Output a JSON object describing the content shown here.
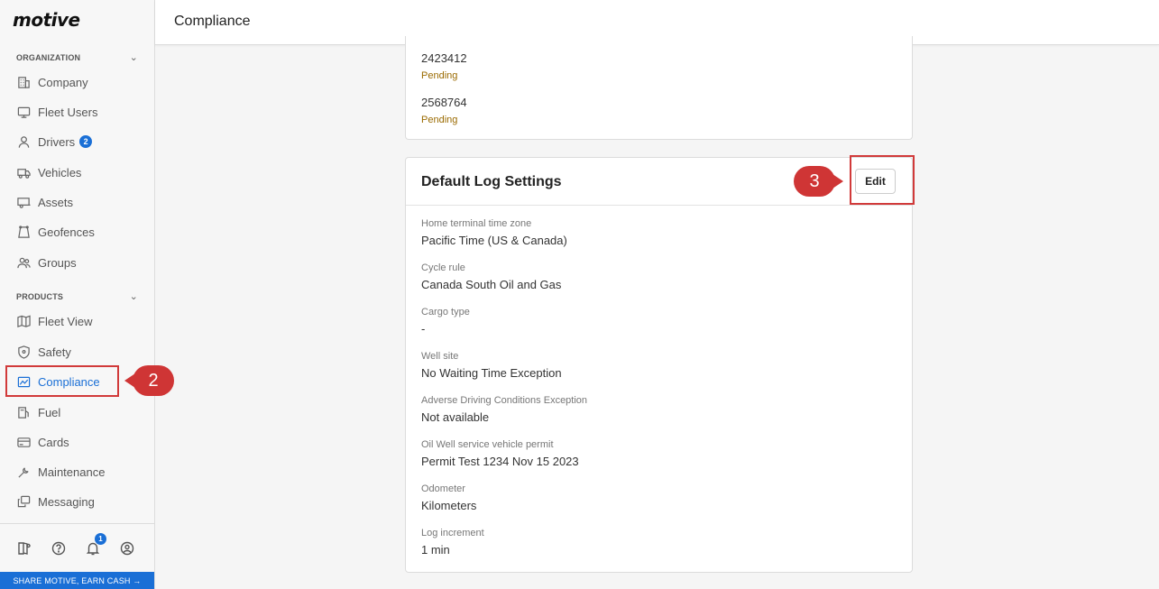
{
  "app": {
    "logo": "motive",
    "page_title": "Compliance"
  },
  "sidebar": {
    "organization_label": "ORGANIZATION",
    "products_label": "PRODUCTS",
    "org_items": [
      {
        "label": "Company",
        "icon": "building-icon"
      },
      {
        "label": "Fleet Users",
        "icon": "monitor-icon"
      },
      {
        "label": "Drivers",
        "icon": "person-icon",
        "badge": "2"
      },
      {
        "label": "Vehicles",
        "icon": "truck-icon"
      },
      {
        "label": "Assets",
        "icon": "trailer-icon"
      },
      {
        "label": "Geofences",
        "icon": "geofence-icon"
      },
      {
        "label": "Groups",
        "icon": "group-icon"
      }
    ],
    "product_items": [
      {
        "label": "Fleet View",
        "icon": "map-icon"
      },
      {
        "label": "Safety",
        "icon": "shield-icon"
      },
      {
        "label": "Compliance",
        "icon": "compliance-icon",
        "active": true
      },
      {
        "label": "Fuel",
        "icon": "fuel-icon"
      },
      {
        "label": "Cards",
        "icon": "card-icon"
      },
      {
        "label": "Maintenance",
        "icon": "wrench-icon"
      },
      {
        "label": "Messaging",
        "icon": "message-icon"
      }
    ],
    "notification_count": "1",
    "share_text": "SHARE MOTIVE, EARN CASH →"
  },
  "callouts": {
    "compliance_step": "2",
    "edit_step": "3"
  },
  "permits": [
    {
      "id": "2423412",
      "status": "Pending"
    },
    {
      "id": "2568764",
      "status": "Pending"
    }
  ],
  "log_settings": {
    "title": "Default Log Settings",
    "edit_label": "Edit",
    "fields": [
      {
        "label": "Home terminal time zone",
        "value": "Pacific Time (US & Canada)"
      },
      {
        "label": "Cycle rule",
        "value": "Canada South Oil and Gas"
      },
      {
        "label": "Cargo type",
        "value": "-"
      },
      {
        "label": "Well site",
        "value": "No Waiting Time Exception"
      },
      {
        "label": "Adverse Driving Conditions Exception",
        "value": "Not available"
      },
      {
        "label": "Oil Well service vehicle permit",
        "value": "Permit Test 1234 Nov 15 2023"
      },
      {
        "label": "Odometer",
        "value": "Kilometers"
      },
      {
        "label": "Log increment",
        "value": "1 min"
      }
    ]
  },
  "colors": {
    "accent": "#1a6fd6",
    "callout": "#cf3535",
    "pending": "#9a6a00"
  }
}
